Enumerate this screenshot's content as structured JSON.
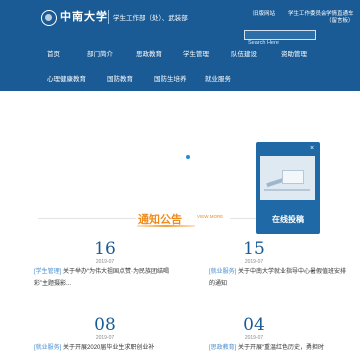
{
  "brand": {
    "name": "中南大学",
    "dept": "学生工作部（处）、武装部"
  },
  "toplinks": [
    "旧版网站",
    "学生工作委员会",
    "学情直通车（留言板）"
  ],
  "search": {
    "placeholder": "Search Here"
  },
  "nav": {
    "row1": [
      "首页",
      "部门简介",
      "思政教育",
      "学生管理",
      "队伍建设",
      "资助管理"
    ],
    "row2": [
      "心理健康教育",
      "国防教育",
      "国防生培养",
      "就业服务"
    ]
  },
  "widget": {
    "label": "在线投稿",
    "close": "×"
  },
  "section": {
    "title": "通知公告",
    "more": "VIEW MORE"
  },
  "news": [
    {
      "day": "16",
      "month": "2019-07",
      "tag": "[学生管理]",
      "text": "关于举办“为伟大祖国点赞·为民族团结喝彩”主题摄影..."
    },
    {
      "day": "15",
      "month": "2019-07",
      "tag": "[就业服务]",
      "text": "关于中南大学就业指导中心暑假值班安排的通知"
    },
    {
      "day": "08",
      "month": "2019-07",
      "tag": "[就业服务]",
      "text": "关于开展2020届毕业生求职创业补"
    },
    {
      "day": "04",
      "month": "2019-07",
      "tag": "[思政教育]",
      "text": "关于开展“重温红色历史，勇担时"
    }
  ]
}
